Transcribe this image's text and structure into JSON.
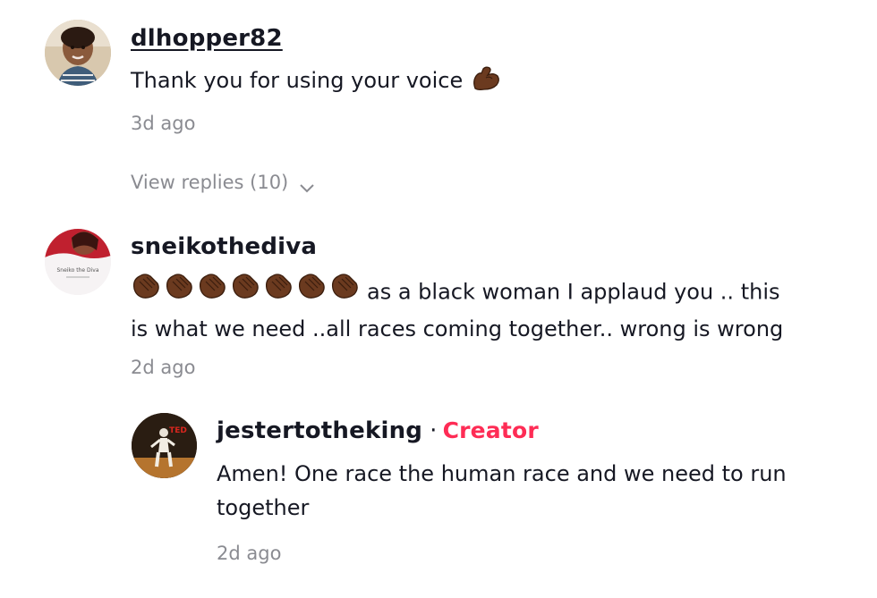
{
  "comments": [
    {
      "username": "dlhopper82",
      "text": "Thank you for using your voice",
      "emoji": "flexed-biceps",
      "timestamp": "3d ago",
      "view_replies": "View replies (10)"
    },
    {
      "username": "sneikothediva",
      "emoji": "clapping-hands",
      "emoji_count": 7,
      "text_line1": "as a black woman I applaud you .. this",
      "text_line2": "is what we need ..all races coming together.. wrong is wrong",
      "timestamp": "2d ago",
      "avatar_caption": "Sneiko the Diva"
    }
  ],
  "reply": {
    "username": "jestertotheking",
    "separator": "·",
    "badge": "Creator",
    "text_line1": "Amen! One race the human race and we need to run",
    "text_line2": "together",
    "timestamp": "2d ago",
    "avatar_caption": "TED"
  },
  "colors": {
    "text": "#161823",
    "muted": "#8a8b91",
    "creator": "#fe2c55",
    "emoji_skin": "#6b3a1f"
  }
}
